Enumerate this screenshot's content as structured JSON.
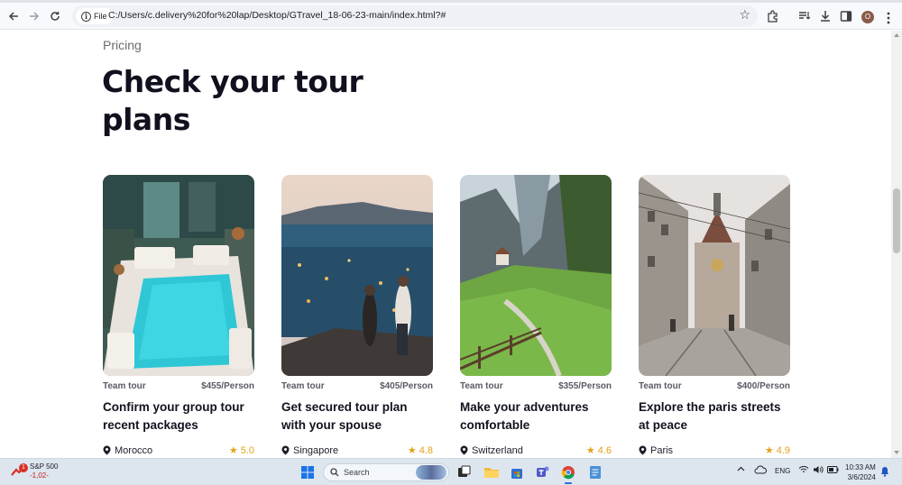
{
  "browser": {
    "address_prefix": "File",
    "url": "C:/Users/c.delivery%20for%20lap/Desktop/GTravel_18-06-23-main/index.html?#",
    "avatar_letter": "O"
  },
  "page": {
    "eyebrow": "Pricing",
    "heading": "Check your tour plans",
    "cards": [
      {
        "category": "Team tour",
        "price": "$455/Person",
        "title": "Confirm your group tour recent packages",
        "location": "Morocco",
        "rating": "5.0",
        "image": "riad-pool-photo"
      },
      {
        "category": "Team tour",
        "price": "$405/Person",
        "title": "Get secured tour plan with your spouse",
        "location": "Singapore",
        "rating": "4.8",
        "image": "couple-city-view-photo"
      },
      {
        "category": "Team tour",
        "price": "$355/Person",
        "title": "Make your adventures comfortable",
        "location": "Switzerland",
        "rating": "4.6",
        "image": "alpine-valley-photo"
      },
      {
        "category": "Team tour",
        "price": "$400/Person",
        "title": "Explore the paris streets at peace",
        "location": "Paris",
        "rating": "4.9",
        "image": "old-town-street-photo"
      }
    ]
  },
  "taskbar": {
    "stock_name": "S&P 500",
    "stock_change": "-1,02-",
    "stock_badge": "1",
    "search_placeholder": "Search",
    "language": "ENG",
    "time": "10:33 AM",
    "date": "3/6/2024"
  },
  "colors": {
    "heading": "#10101e",
    "rating": "#e3a21a",
    "taskbar": "#dde6ef"
  }
}
